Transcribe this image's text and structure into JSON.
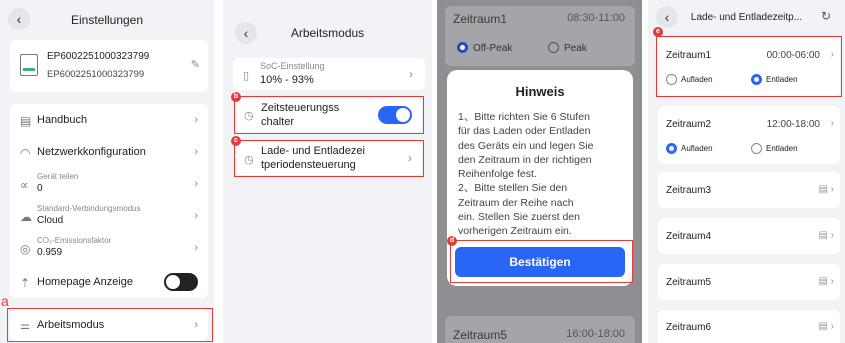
{
  "panel1": {
    "title": "Einstellungen",
    "device_serial_1": "EP6002251000323799",
    "device_serial_2": "EP6002251000323799",
    "menu": {
      "manual": "Handbuch",
      "network": "Netzwerkkonfiguration",
      "share_label": "Gerät teilen",
      "share_value": "0",
      "conn_label": "Standard-Verbindungsmodus",
      "conn_value": "Cloud",
      "co2_label": "CO₂-Emissionsfaktor",
      "co2_value": "0.959",
      "homepage": "Homepage Anzeige",
      "work_mode": "Arbeitsmodus"
    },
    "marker": "a"
  },
  "panel2": {
    "title": "Arbeitsmodus",
    "soc_label": "SoC-Einstellung",
    "soc_value": "10% - 93%",
    "time_switch_1": "Zeitsteuerungss",
    "time_switch_2": "chalter",
    "charge_1": "Lade- und Entladezei",
    "charge_2": "tperiodensteuerung",
    "marker_b": "b",
    "marker_c": "c"
  },
  "panel3": {
    "bg_top_label": "Zeitraum1",
    "bg_top_time": "08:30-11:00",
    "off_peak": "Off-Peak",
    "peak": "Peak",
    "dialog_title": "Hinweis",
    "line_1": "1、Bitte richten Sie 6 Stufen",
    "line_2": "für das Laden oder Entladen",
    "line_3": "des Geräts ein und legen Sie",
    "line_4": "den Zeitraum in der richtigen",
    "line_5": "Reihenfolge fest.",
    "line_6": "2、Bitte stellen Sie den",
    "line_7": "Zeitraum der Reihe nach",
    "line_8": "ein. Stellen Sie zuerst den",
    "line_9": "vorherigen Zeitraum ein.",
    "confirm": "Bestätigen",
    "bg_bottom_label": "Zeitraum5",
    "bg_bottom_time": "16:00-18:00",
    "marker_d": "d"
  },
  "panel4": {
    "title": "Lade- und Entladezeitp...",
    "charge": "Aufladen",
    "discharge": "Entladen",
    "periods": [
      {
        "label": "Zeitraum1",
        "time": "00:00-06:00"
      },
      {
        "label": "Zeitraum2",
        "time": "12:00-18:00"
      },
      {
        "label": "Zeitraum3",
        "time": ""
      },
      {
        "label": "Zeitraum4",
        "time": ""
      },
      {
        "label": "Zeitraum5",
        "time": ""
      },
      {
        "label": "Zeitraum6",
        "time": ""
      }
    ],
    "marker_e": "e"
  },
  "colors": {
    "accent": "#2a66f5",
    "highlight": "#e53a3a",
    "dark_toggle": "#222222"
  }
}
